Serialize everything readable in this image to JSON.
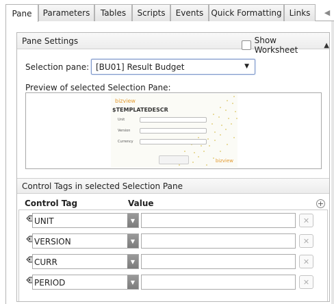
{
  "tabs": [
    {
      "label": "Pane",
      "active": true
    },
    {
      "label": "Parameters",
      "active": false
    },
    {
      "label": "Tables",
      "active": false
    },
    {
      "label": "Scripts",
      "active": false
    },
    {
      "label": "Events",
      "active": false
    },
    {
      "label": "Quick Formatting",
      "active": false
    },
    {
      "label": "Links",
      "active": false
    }
  ],
  "pane_settings": {
    "title": "Pane Settings",
    "show_worksheet_label": "Show Worksheet",
    "show_worksheet_checked": false,
    "selection_pane_label": "Selection pane:",
    "selection_pane_value": "[BU01] Result Budget",
    "preview_label": "Preview of selected Selection Pane:",
    "preview": {
      "logo": "bizview",
      "title": "$TEMPLATEDESCR",
      "fields": [
        "Unit",
        "Version",
        "Currency"
      ]
    }
  },
  "control_tags": {
    "title": "Control Tags in selected Selection Pane",
    "col_tag": "Control Tag",
    "col_value": "Value",
    "rows": [
      {
        "tag": "UNIT",
        "value": ""
      },
      {
        "tag": "VERSION",
        "value": ""
      },
      {
        "tag": "CURR",
        "value": ""
      },
      {
        "tag": "PERIOD",
        "value": ""
      }
    ]
  },
  "colors": {
    "accent_border": "#7c95c8",
    "tab_bg": "#e4e4e4",
    "dropdown_button": "#888888"
  }
}
